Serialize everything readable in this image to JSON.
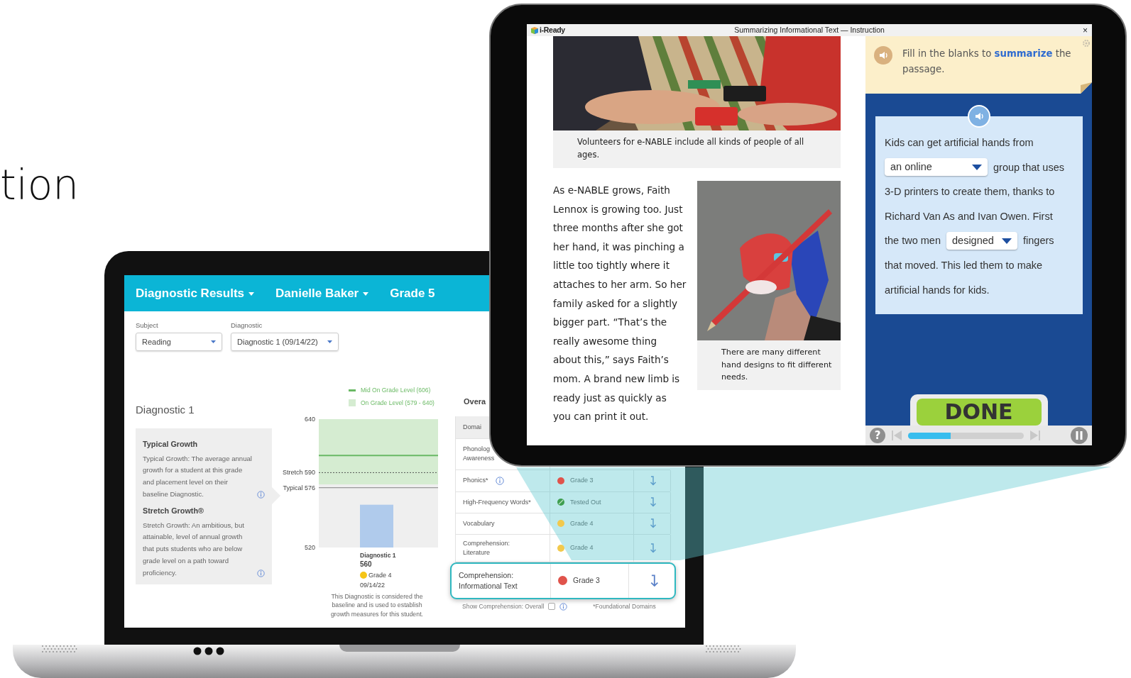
{
  "backdrop_heading": "tion",
  "laptop": {
    "nav": [
      {
        "label": "Diagnostic Results",
        "dropdown": true
      },
      {
        "label": "Danielle Baker",
        "dropdown": true
      },
      {
        "label": "Grade 5",
        "dropdown": false
      }
    ],
    "filters": [
      {
        "label": "Subject",
        "value": "Reading"
      },
      {
        "label": "Diagnostic",
        "value": "Diagnostic 1 (09/14/22)"
      }
    ],
    "heading": "Diagnostic 1",
    "info": [
      {
        "title": "Typical Growth",
        "text": "Typical Growth: The average annual growth for a student at this grade and placement level on their baseline Diagnostic."
      },
      {
        "title": "Stretch Growth®",
        "text": "Stretch Growth: An ambitious, but attainable, level of annual growth that puts students who are below grade level on a path toward proficiency."
      }
    ],
    "chart": {
      "chart_data": {
        "type": "bar",
        "categories": [
          "Diagnostic 1"
        ],
        "values": [
          560
        ],
        "ylim": [
          520,
          640
        ],
        "yticks": [
          520,
          {
            "value": 576,
            "label": "Typical 576"
          },
          {
            "value": 590,
            "label": "Stretch 590"
          },
          640
        ],
        "ref_lines": [
          {
            "axis": "y",
            "value": 606,
            "label": "Mid On Grade Level (606)"
          },
          {
            "axis": "y",
            "value": 590
          },
          {
            "axis": "y",
            "value": 576
          }
        ],
        "bands": [
          {
            "axis": "y",
            "from": 579,
            "to": 640,
            "label": "On Grade Level (579 - 640)"
          }
        ]
      },
      "score": "560",
      "placement": {
        "label": "Grade 4",
        "color": "#f5c518"
      },
      "date": "09/14/22",
      "note": "This Diagnostic is considered the baseline and is used to establish growth measures for this student."
    },
    "table": {
      "title": "Overa",
      "columns": [
        "Domai"
      ],
      "rows": [
        {
          "domain": "Phonolog\nAwareness",
          "highlighted": false
        },
        {
          "domain": "Phonics*",
          "info": true,
          "placement": "Grade 3",
          "color": "#e0534b",
          "kind": "dot",
          "highlighted": false
        },
        {
          "domain": "High-Frequency Words*",
          "placement": "Tested Out",
          "color": "#3e9e4f",
          "kind": "tested-out",
          "highlighted": false
        },
        {
          "domain": "Vocabulary",
          "placement": "Grade 4",
          "color": "#f2c94c",
          "kind": "dot",
          "highlighted": false
        },
        {
          "domain": "Comprehension:\nLiterature",
          "placement": "Grade 4",
          "color": "#f2c94c",
          "kind": "dot",
          "highlighted": false
        },
        {
          "domain": "Comprehension:\nInformational Text",
          "placement": "Grade 3",
          "color": "#e0534b",
          "kind": "dot",
          "highlighted": true
        }
      ],
      "footer": {
        "toggle_label": "Show Comprehension: Overall",
        "checked": false,
        "note": "*Foundational Domains"
      }
    }
  },
  "tablet": {
    "app_name": "i-Ready",
    "title": "Summarizing Informational Text — Instruction",
    "close": "×",
    "photo_caption": "Volunteers for e-NABLE include all kinds of people of all ages.",
    "paragraph": "As e-NABLE grows, Faith Lennox is growing too. Just three months after she got her hand, it was pinching a little too tightly where it attaches to her arm. So her family asked for a slightly bigger part. “That’s the really awesome thing about this,” says Faith’s mom. A brand new limb is ready just as quickly as you can print it out.",
    "figure_caption": "There are many different hand designs to fit different needs.",
    "prompt": "Fill in the blanks to **summarize** the passage.",
    "summary_lines": [
      [
        {
          "kind": "text",
          "text": "Kids can get artificial hands from"
        }
      ],
      [
        {
          "kind": "select",
          "value": "an online"
        },
        {
          "kind": "text",
          "text": "group that uses"
        }
      ],
      [
        {
          "kind": "text",
          "text": "3-D printers to create them, thanks to"
        }
      ],
      [
        {
          "kind": "text",
          "text": "Richard Van As and Ivan Owen. First"
        }
      ],
      [
        {
          "kind": "text",
          "text": "the two men"
        },
        {
          "kind": "select",
          "value": "designed"
        },
        {
          "kind": "text",
          "text": "fingers"
        }
      ],
      [
        {
          "kind": "text",
          "text": "that moved. This led them to make"
        }
      ],
      [
        {
          "kind": "text",
          "text": "artificial hands for kids."
        }
      ]
    ],
    "done": "DONE",
    "help": "?",
    "progress": {
      "level": 0.37
    }
  }
}
